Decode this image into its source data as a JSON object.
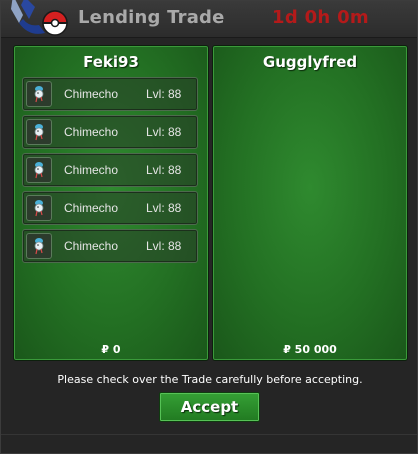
{
  "window": {
    "title": "Lending Trade",
    "timer": "1d 0h 0m"
  },
  "left_panel": {
    "player_name": "Feki93",
    "items": [
      {
        "icon": "chimecho-icon",
        "name": "Chimecho",
        "level": "Lvl: 88"
      },
      {
        "icon": "chimecho-icon",
        "name": "Chimecho",
        "level": "Lvl: 88"
      },
      {
        "icon": "chimecho-icon",
        "name": "Chimecho",
        "level": "Lvl: 88"
      },
      {
        "icon": "chimecho-icon",
        "name": "Chimecho",
        "level": "Lvl: 88"
      },
      {
        "icon": "chimecho-icon",
        "name": "Chimecho",
        "level": "Lvl: 88"
      }
    ],
    "money": "₽ 0"
  },
  "right_panel": {
    "player_name": "Gugglyfred",
    "items": [],
    "money": "₽ 50 000"
  },
  "notice": "Please check over the Trade carefully before accepting.",
  "accept_label": "Accept",
  "colors": {
    "timer": "#b41a1a",
    "panel_green": "#237023",
    "button_green": "#2a8c2a",
    "title_gray": "#a9a9a9"
  }
}
